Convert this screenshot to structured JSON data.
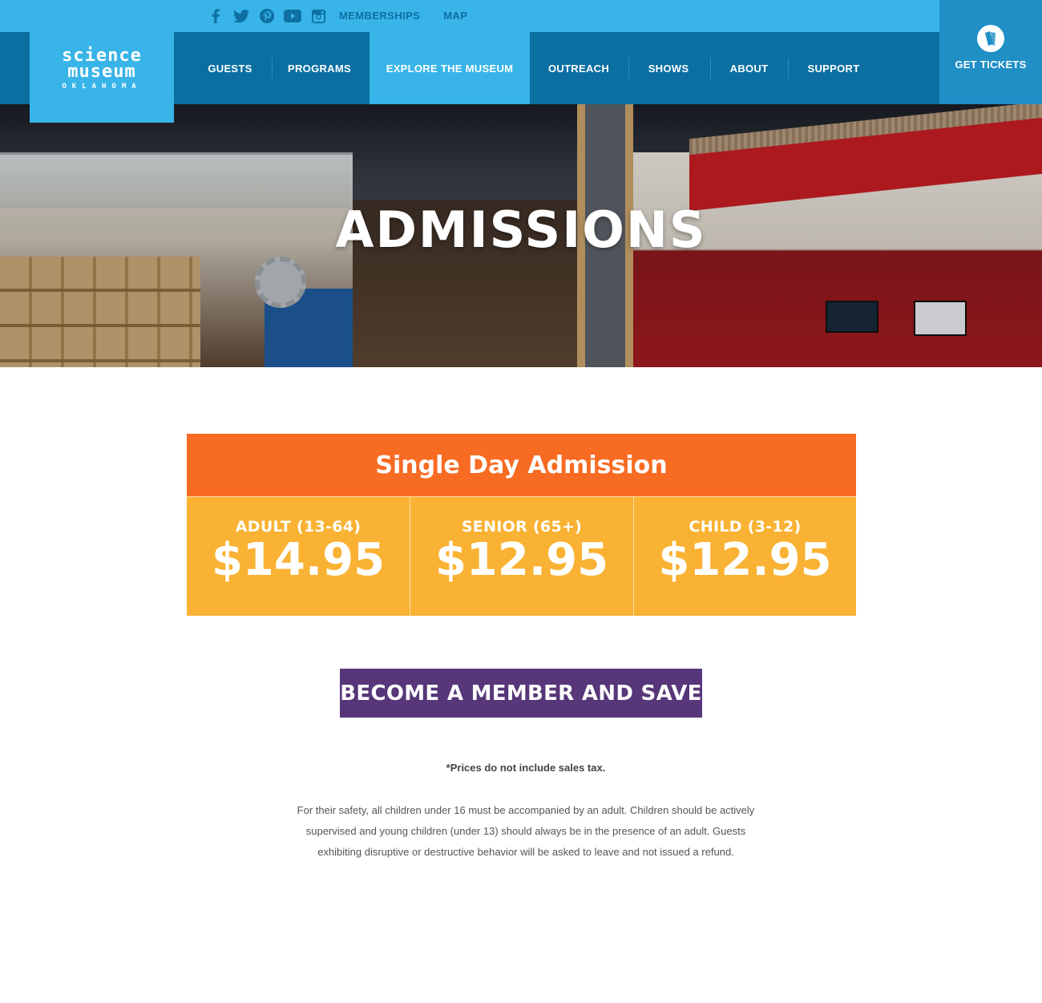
{
  "social": {
    "icons": [
      "facebook-icon",
      "twitter-icon",
      "pinterest-icon",
      "youtube-icon",
      "instagram-icon"
    ]
  },
  "top_links": {
    "memberships": "MEMBERSHIPS",
    "map": "MAP"
  },
  "logo": {
    "line1": "science",
    "line2": "museum",
    "line3": "OKLAHOMA"
  },
  "nav": {
    "items": [
      {
        "label": "GUESTS"
      },
      {
        "label": "PROGRAMS"
      },
      {
        "label": "EXPLORE THE MUSEUM",
        "active": true
      },
      {
        "label": "OUTREACH"
      },
      {
        "label": "SHOWS"
      },
      {
        "label": "ABOUT"
      },
      {
        "label": "SUPPORT"
      }
    ]
  },
  "tickets": {
    "label": "GET TICKETS",
    "icon": "ticket-icon"
  },
  "hero": {
    "title": "ADMISSIONS"
  },
  "pricing": {
    "title": "Single Day Admission",
    "tiers": [
      {
        "label": "ADULT (13-64)",
        "price": "$14.95"
      },
      {
        "label": "SENIOR (65+)",
        "price": "$12.95"
      },
      {
        "label": "CHILD (3-12)",
        "price": "$12.95"
      }
    ]
  },
  "cta": {
    "label": "BECOME A MEMBER AND SAVE"
  },
  "notes": {
    "tax": "*Prices do not include sales tax.",
    "safety": "For their safety, all children under 16 must be accompanied by an adult. Children should be actively supervised and young children (under 13) should always be in the presence of an adult. Guests exhibiting disruptive or destructive behavior will be asked to leave and not issued a refund."
  },
  "colors": {
    "light_blue": "#38b4e8",
    "dark_blue": "#0b6fa2",
    "orange": "#f76b22",
    "yellow": "#f9b233",
    "purple": "#573679"
  }
}
